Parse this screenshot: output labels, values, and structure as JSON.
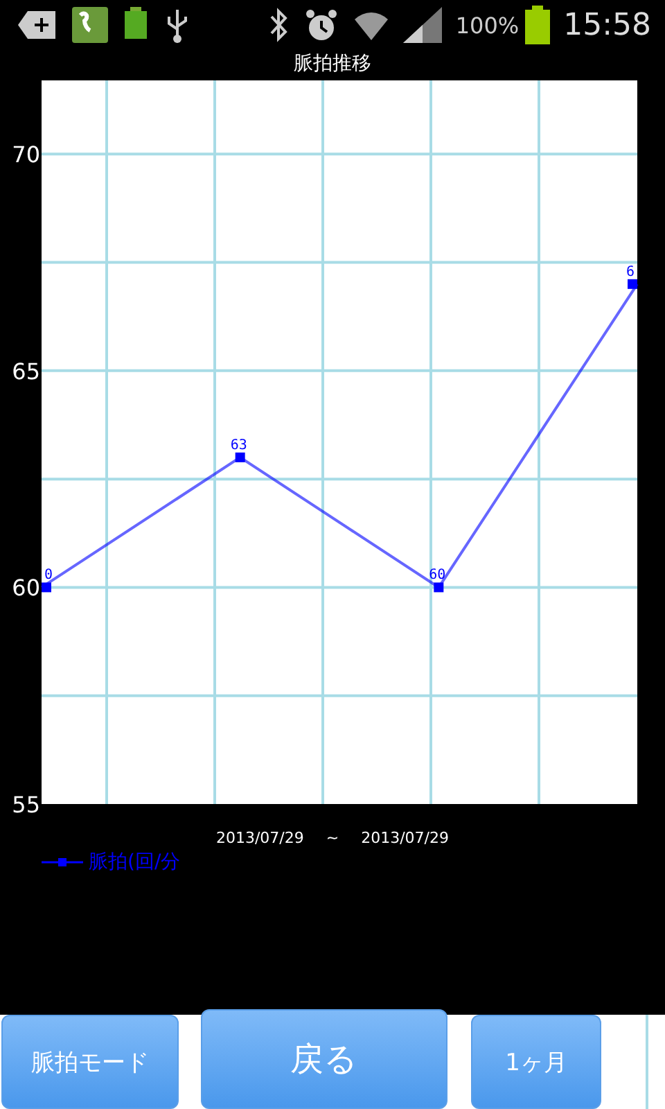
{
  "status_bar": {
    "battery_text": "100%",
    "time": "15:58"
  },
  "chart": {
    "chart_data": {
      "type": "line",
      "title": "脈拍推移",
      "grid": true,
      "ylim": [
        55,
        71.7
      ],
      "yticks": [
        55,
        60,
        65,
        70
      ],
      "series": [
        {
          "name": "脈拍(回/分",
          "color": "#0000ff",
          "marker": "square",
          "values": [
            60,
            63,
            60,
            67
          ]
        }
      ],
      "value_labels": [
        "0",
        "63",
        "60",
        "6"
      ]
    }
  },
  "date_range": {
    "from": "2013/07/29",
    "separator": "~",
    "to": "2013/07/29"
  },
  "buttons": [
    {
      "label": "脈拍モード",
      "kind": "mode"
    },
    {
      "label": "戻る",
      "kind": "back"
    },
    {
      "label": "1ヶ月",
      "kind": "period"
    }
  ]
}
